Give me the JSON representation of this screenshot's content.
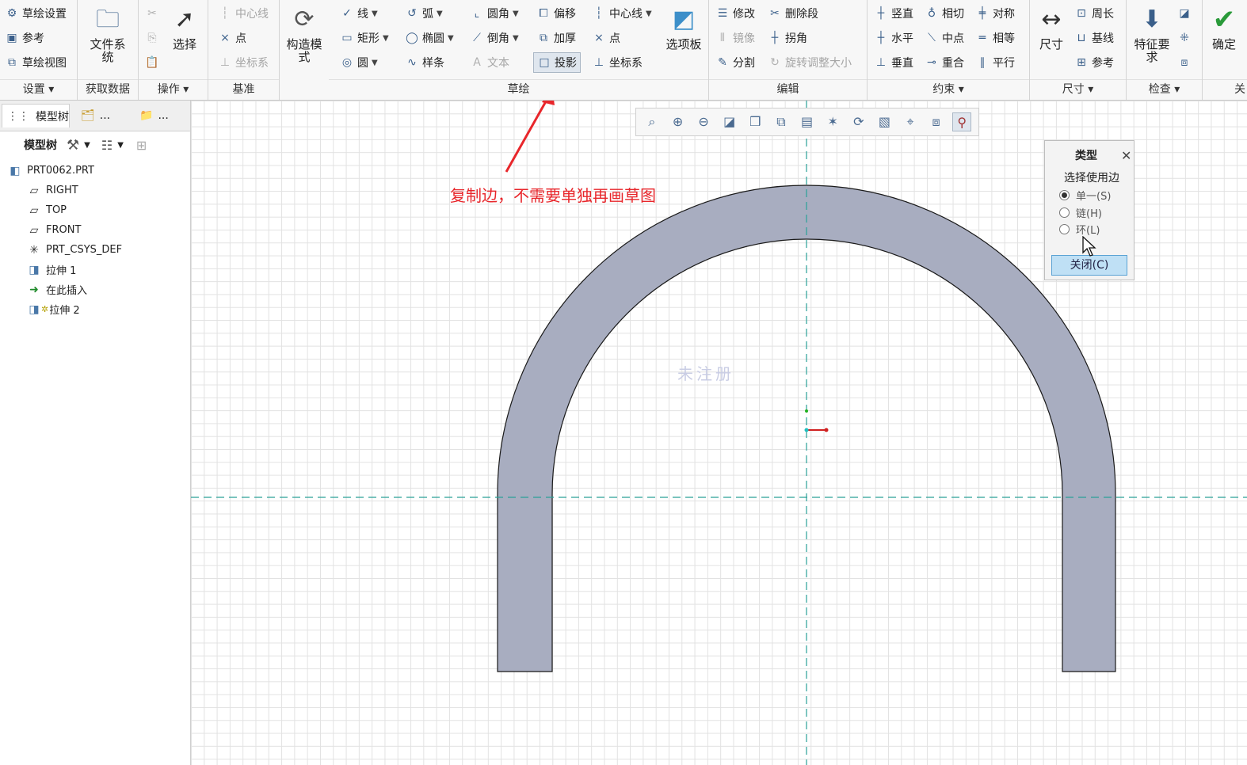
{
  "ribbon": {
    "settings": {
      "label": "设置",
      "sketch_setup": "草绘设置",
      "references": "参考",
      "sketch_view": "草绘视图"
    },
    "get_data": {
      "label": "获取数据",
      "file_system": "文件系统"
    },
    "operations": {
      "label": "操作",
      "select": "选择"
    },
    "datum": {
      "label": "基准",
      "centerline": "中心线",
      "point": "点",
      "csys": "坐标系"
    },
    "construction": {
      "mode": "构造模式"
    },
    "sketch": {
      "label": "草绘",
      "line": "线",
      "rectangle": "矩形",
      "circle": "圆",
      "arc": "弧",
      "ellipse": "椭圆",
      "spline": "样条",
      "fillet": "圆角",
      "chamfer": "倒角",
      "text": "文本",
      "offset": "偏移",
      "thicken": "加厚",
      "project": "投影",
      "centerline": "中心线",
      "point": "点",
      "csys": "坐标系",
      "palette": "选项板"
    },
    "edit": {
      "label": "编辑",
      "modify": "修改",
      "delete_segment": "删除段",
      "mirror": "镜像",
      "corner": "拐角",
      "divide": "分割",
      "rotate_resize": "旋转调整大小"
    },
    "constrain": {
      "label": "约束",
      "vertical": "竖直",
      "tangent": "相切",
      "symmetric": "对称",
      "horizontal": "水平",
      "midpoint": "中点",
      "equal": "相等",
      "perpendicular": "垂直",
      "coincident": "重合",
      "parallel": "平行"
    },
    "dimension": {
      "label": "尺寸",
      "dimension": "尺寸",
      "perimeter": "周长",
      "baseline": "基线",
      "reference": "参考"
    },
    "inspect": {
      "label": "检查",
      "feature_requirements": "特征要求"
    },
    "confirm": {
      "ok": "确定",
      "close_partial": "关"
    }
  },
  "left_panel": {
    "tab_model_tree": "模型树",
    "tab_more1": "...",
    "tab_more2": "...",
    "toolbar_label": "模型树",
    "tree": [
      {
        "label": "PRT0062.PRT",
        "icon": "part-icon"
      },
      {
        "label": "RIGHT",
        "icon": "datum-plane-icon"
      },
      {
        "label": "TOP",
        "icon": "datum-plane-icon"
      },
      {
        "label": "FRONT",
        "icon": "datum-plane-icon"
      },
      {
        "label": "PRT_CSYS_DEF",
        "icon": "csys-icon"
      },
      {
        "label": "拉伸 1",
        "icon": "extrude-icon"
      },
      {
        "label": "在此插入",
        "icon": "insert-here-icon"
      },
      {
        "label": "拉伸 2",
        "icon": "extrude-icon"
      }
    ]
  },
  "dialog": {
    "title": "类型",
    "group_label": "选择使用边",
    "options": [
      {
        "label": "单一(S)",
        "selected": true
      },
      {
        "label": "链(H)",
        "selected": false
      },
      {
        "label": "环(L)",
        "selected": false
      }
    ],
    "close_button": "关闭(C)"
  },
  "annotation": "复制边，不需要单独再画草图",
  "watermark": "未注册",
  "colors": {
    "accent": "#3a5f8a",
    "annotation": "#e8262b",
    "shape_fill": "#a8adc0",
    "centerline": "#2aa198"
  }
}
